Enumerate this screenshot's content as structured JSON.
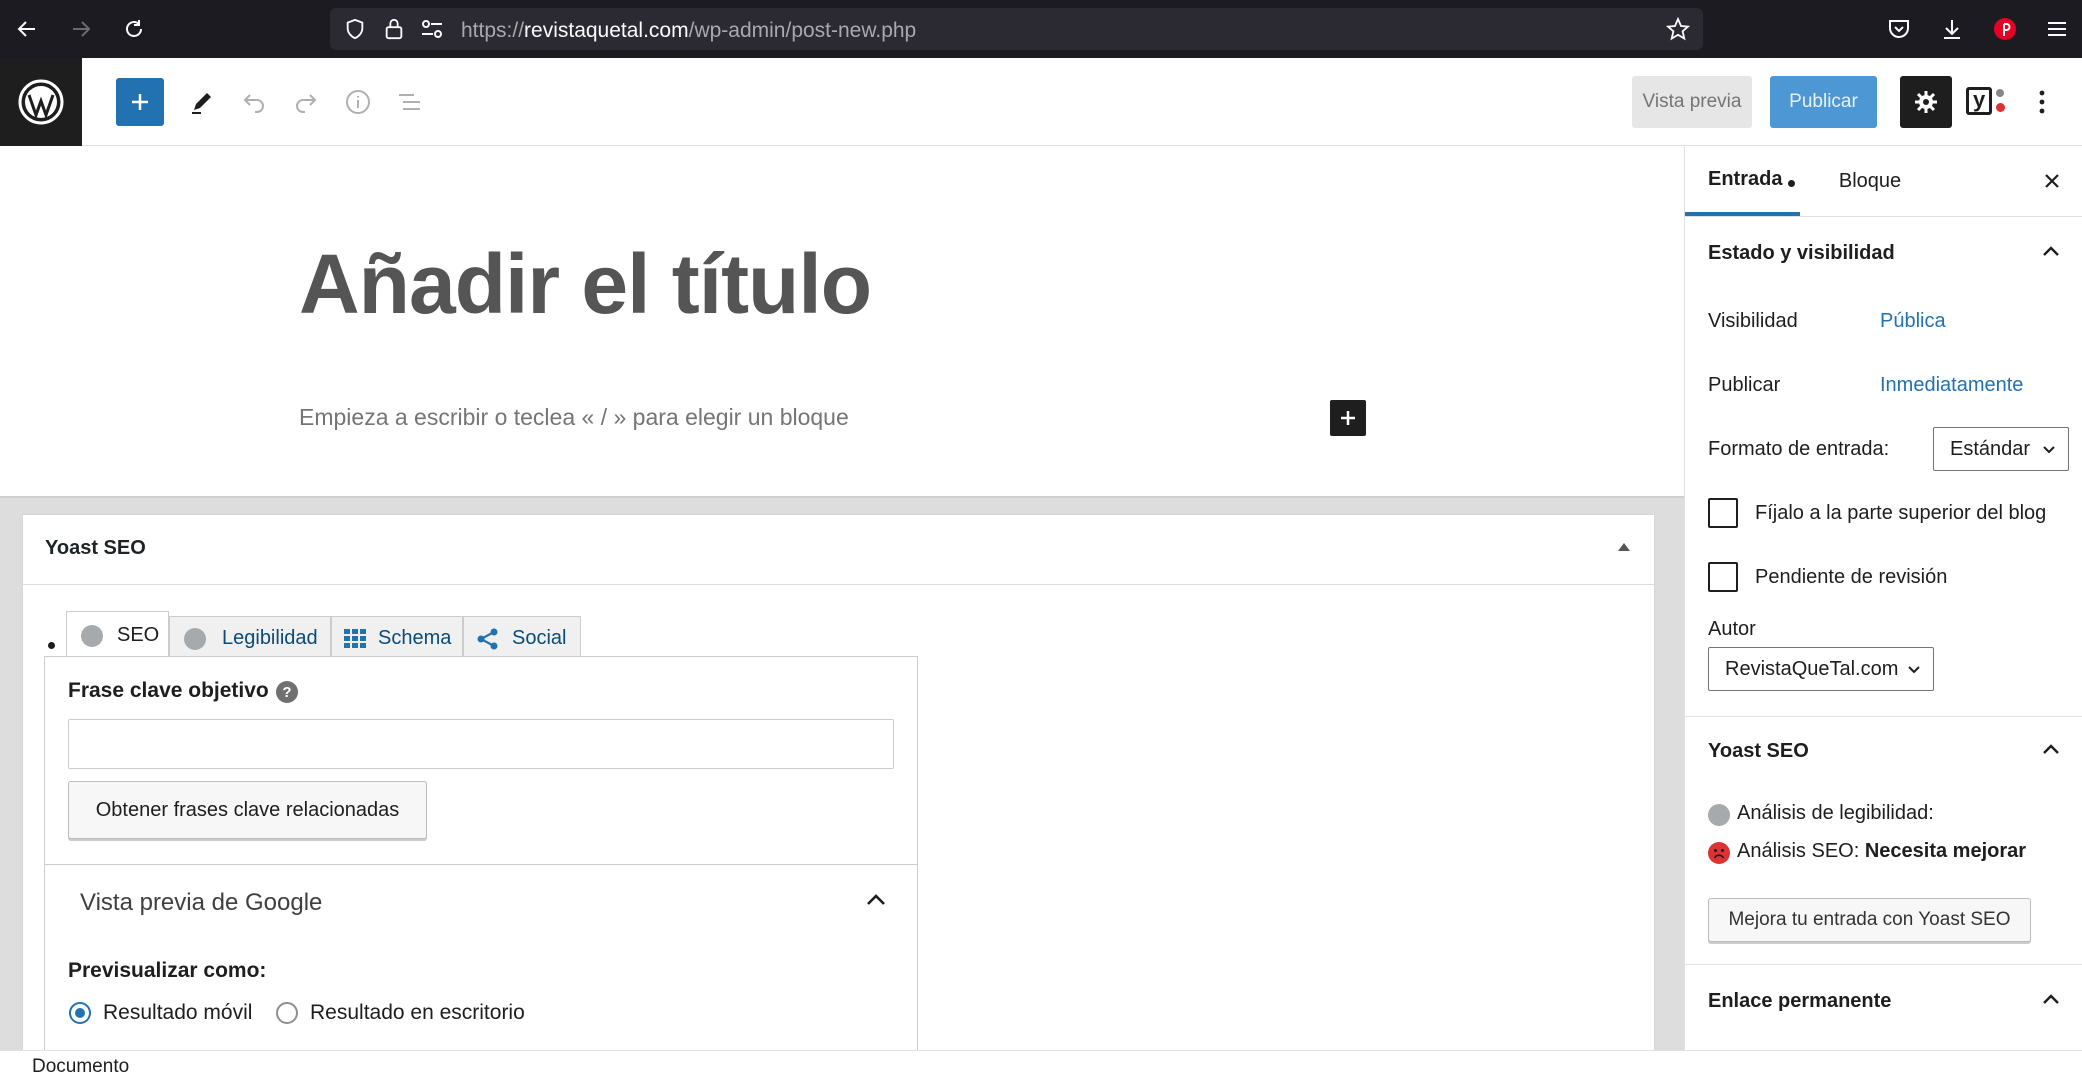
{
  "browser": {
    "url_prefix": "https://",
    "url_domain": "revistaquetal.com",
    "url_path": "/wp-admin/post-new.php"
  },
  "toolbar": {
    "preview_label": "Vista previa",
    "publish_label": "Publicar",
    "yoast_badge": "y"
  },
  "editor": {
    "title_placeholder": "Añadir el título",
    "paragraph_placeholder": "Empieza a escribir o teclea « / » para elegir un bloque"
  },
  "yoast": {
    "title": "Yoast SEO",
    "tabs": [
      {
        "label": "SEO"
      },
      {
        "label": "Legibilidad"
      },
      {
        "label": "Schema"
      },
      {
        "label": "Social"
      }
    ],
    "focus_keyphrase_label": "Frase clave objetivo",
    "focus_keyphrase_value": "",
    "related_button": "Obtener frases clave relacionadas",
    "google_preview_title": "Vista previa de Google",
    "preview_as_label": "Previsualizar como:",
    "radio_mobile": "Resultado móvil",
    "radio_desktop": "Resultado en escritorio",
    "selected_preview": "mobile"
  },
  "sidebar": {
    "tab_post": "Entrada",
    "tab_block": "Bloque",
    "status_title": "Estado y visibilidad",
    "visibility_label": "Visibilidad",
    "visibility_value": "Pública",
    "publish_label": "Publicar",
    "publish_value": "Inmediatamente",
    "format_label": "Formato de entrada:",
    "format_value": "Estándar",
    "sticky_label": "Fíjalo a la parte superior del blog",
    "sticky_checked": false,
    "pending_label": "Pendiente de revisión",
    "pending_checked": false,
    "author_label": "Autor",
    "author_value": "RevistaQueTal.com",
    "yoast_title": "Yoast SEO",
    "readability_label": "Análisis de legibilidad:",
    "seo_label": "Análisis SEO:",
    "seo_value": "Necesita mejorar",
    "improve_button": "Mejora tu entrada con Yoast SEO",
    "permalink_title": "Enlace permanente"
  },
  "footer": {
    "breadcrumb": "Documento"
  },
  "colors": {
    "accent": "#2271b1",
    "dark": "#1e1e1e",
    "score_gray": "#a7aaad",
    "score_bad": "#dc3232"
  }
}
